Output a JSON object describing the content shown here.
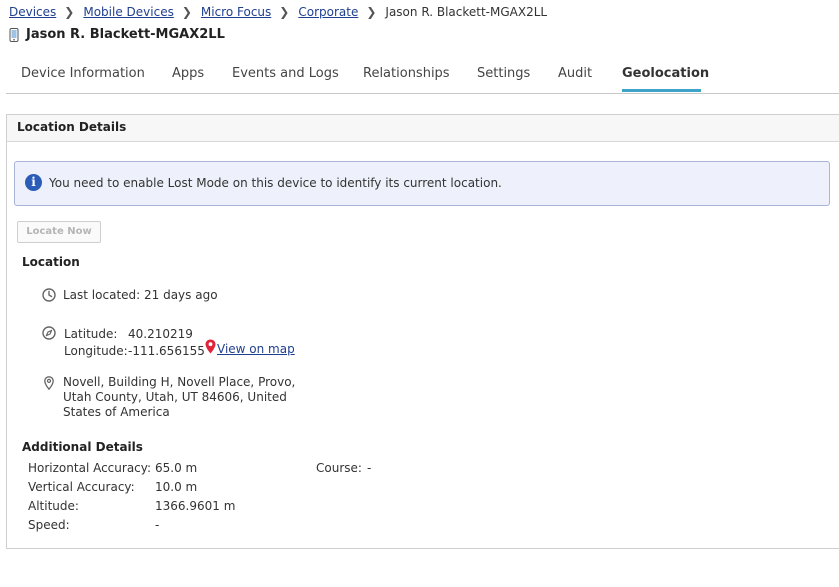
{
  "breadcrumb": {
    "items": [
      "Devices",
      "Mobile Devices",
      "Micro Focus",
      "Corporate"
    ],
    "current": "Jason R. Blackett-MGAX2LL"
  },
  "device": {
    "title": "Jason R. Blackett-MGAX2LL"
  },
  "tabs": [
    {
      "label": "Device Information",
      "active": false
    },
    {
      "label": "Apps",
      "active": false
    },
    {
      "label": "Events and Logs",
      "active": false
    },
    {
      "label": "Relationships",
      "active": false
    },
    {
      "label": "Settings",
      "active": false
    },
    {
      "label": "Audit",
      "active": false
    },
    {
      "label": "Geolocation",
      "active": true
    }
  ],
  "panel": {
    "title": "Location Details"
  },
  "info": {
    "message": "You need to enable Lost Mode on this device to identify its current location."
  },
  "locate_button": {
    "label": "Locate Now",
    "disabled": true
  },
  "location": {
    "heading": "Location",
    "last_located": "Last located: 21 days ago",
    "latitude_label": "Latitude:",
    "latitude": "40.210219",
    "longitude_label": "Longitude:",
    "longitude": "-111.656155",
    "map_link": "View on map",
    "address": "Novell, Building H, Novell Place, Provo, Utah County, Utah, UT 84606, United States of America"
  },
  "additional": {
    "heading": "Additional Details",
    "horizontal_label": "Horizontal Accuracy:",
    "horizontal_value": "65.0 m",
    "vertical_label": "Vertical Accuracy:",
    "vertical_value": "10.0 m",
    "altitude_label": "Altitude:",
    "altitude_value": "1366.9601 m",
    "speed_label": "Speed:",
    "speed_value": "-",
    "course_label": "Course:",
    "course_value": "-"
  },
  "colors": {
    "link": "#1f3f8f",
    "tab_accent": "#3ea3c8",
    "info_bg": "#eef1fb",
    "info_border": "#a9b4d6",
    "info_icon": "#2b5cb8",
    "map_pin": "#e0243a"
  },
  "icons": {
    "device": "mobile-device-icon",
    "info": "info-icon",
    "clock": "clock-icon",
    "compass": "compass-icon",
    "pin": "map-pin-icon",
    "location": "location-marker-icon"
  }
}
